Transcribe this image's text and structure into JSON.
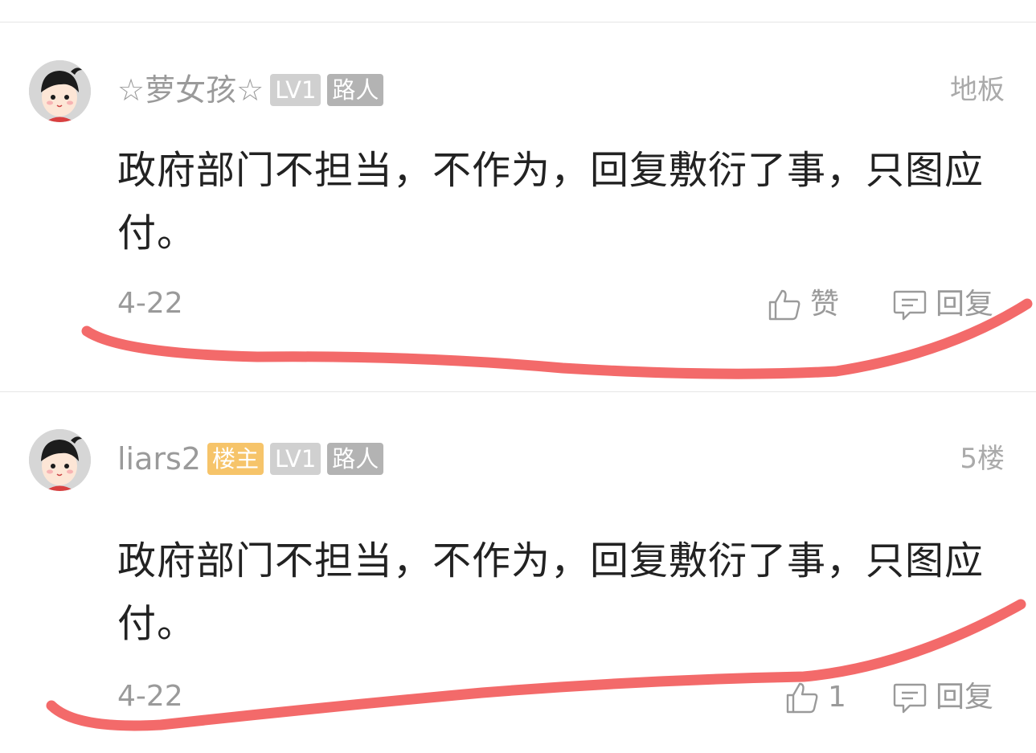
{
  "comments": [
    {
      "username": "☆萝女孩☆",
      "badges": {
        "op": "",
        "level": "LV1",
        "role": "路人"
      },
      "floor": "地板",
      "text": "政府部门不担当，不作为，回复敷衍了事，只图应付。",
      "date": "4-22",
      "like_label": "赞",
      "reply_label": "回复"
    },
    {
      "username": "liars2",
      "badges": {
        "op": "楼主",
        "level": "LV1",
        "role": "路人"
      },
      "floor": "5楼",
      "text": "政府部门不担当，不作为，回复敷衍了事，只图应付。",
      "date": "4-22",
      "like_label": "1",
      "reply_label": "回复"
    }
  ],
  "icons": {
    "avatar": "avatar-icon",
    "like": "thumbs-up-icon",
    "reply": "comment-bubble-icon"
  },
  "colors": {
    "text_primary": "#222222",
    "text_secondary": "#9a9a9a",
    "badge_level": "#d0d0d0",
    "badge_role": "#b3b3b3",
    "badge_op": "#f6c46a",
    "annotation": "#f25a5a"
  }
}
